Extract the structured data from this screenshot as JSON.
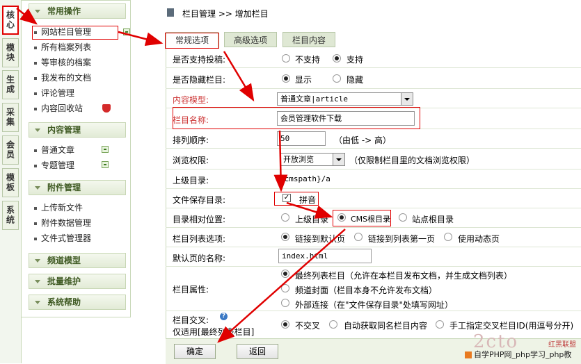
{
  "vtabs": [
    "核心",
    "模块",
    "生成",
    "采集",
    "会员",
    "模板",
    "系统"
  ],
  "sidebar": {
    "groups": [
      {
        "title": "常用操作",
        "items": [
          "网站栏目管理",
          "所有档案列表",
          "等审核的档案",
          "我发布的文档",
          "评论管理",
          "内容回收站"
        ]
      },
      {
        "title": "内容管理",
        "items": [
          "普通文章",
          "专题管理"
        ]
      },
      {
        "title": "附件管理",
        "items": [
          "上传新文件",
          "附件数据管理",
          "文件式管理器"
        ]
      },
      {
        "title": "频道模型",
        "items": []
      },
      {
        "title": "批量维护",
        "items": []
      },
      {
        "title": "系统帮助",
        "items": []
      }
    ]
  },
  "breadcrumb": {
    "section": "栏目管理",
    "sep": ">>",
    "page": "增加栏目"
  },
  "tabs": [
    "常规选项",
    "高级选项",
    "栏目内容"
  ],
  "form": {
    "allow_post": {
      "label": "是否支持投稿:",
      "opt1": "不支持",
      "opt2": "支持"
    },
    "hidden": {
      "label": "是否隐藏栏目:",
      "opt1": "显示",
      "opt2": "隐藏"
    },
    "content_model": {
      "label": "内容模型:",
      "value": "普通文章|article"
    },
    "name": {
      "label": "栏目名称:",
      "value": "会员管理软件下载"
    },
    "order": {
      "label": "排列顺序:",
      "value": "50",
      "hint": "（由低 -> 高）"
    },
    "browse": {
      "label": "浏览权限:",
      "value": "开放浏览",
      "hint": "（仅限制栏目里的文档浏览权限）"
    },
    "parent_dir": {
      "label": "上级目录:",
      "value": "{cmspath}/a"
    },
    "save_dir": {
      "label": "文件保存目录:",
      "chk": "拼音"
    },
    "rel_pos": {
      "label": "目录相对位置:",
      "opt1": "上级目录",
      "opt2": "CMS根目录",
      "opt3": "站点根目录"
    },
    "list_opt": {
      "label": "栏目列表选项:",
      "opt1": "链接到默认页",
      "opt2": "链接到列表第一页",
      "opt3": "使用动态页"
    },
    "default_page": {
      "label": "默认页的名称:",
      "value": "index.html"
    },
    "attr": {
      "label": "栏目属性:",
      "opt1": "最终列表栏目（允许在本栏目发布文档，并生成文档列表）",
      "opt2": "频道封面（栏目本身不允许发布文档）",
      "opt3": "外部连接（在\"文件保存目录\"处填写网址）"
    },
    "cross": {
      "label": "栏目交叉:",
      "sub": "仅适用[最终列表栏目]",
      "opt1": "不交叉",
      "opt2": "自动获取同名栏目内容",
      "opt3": "手工指定交叉栏目ID(用逗号分开)"
    }
  },
  "buttons": {
    "ok": "确定",
    "back": "返回"
  },
  "watermark": {
    "site": "自学PHP网_php学习_php教",
    "logo1": "2cto",
    "logo2": "红黑联盟"
  },
  "colors": {
    "accent_red": "#e00000",
    "label_red": "#cc3333",
    "group_bg": "#e2ebd6"
  }
}
